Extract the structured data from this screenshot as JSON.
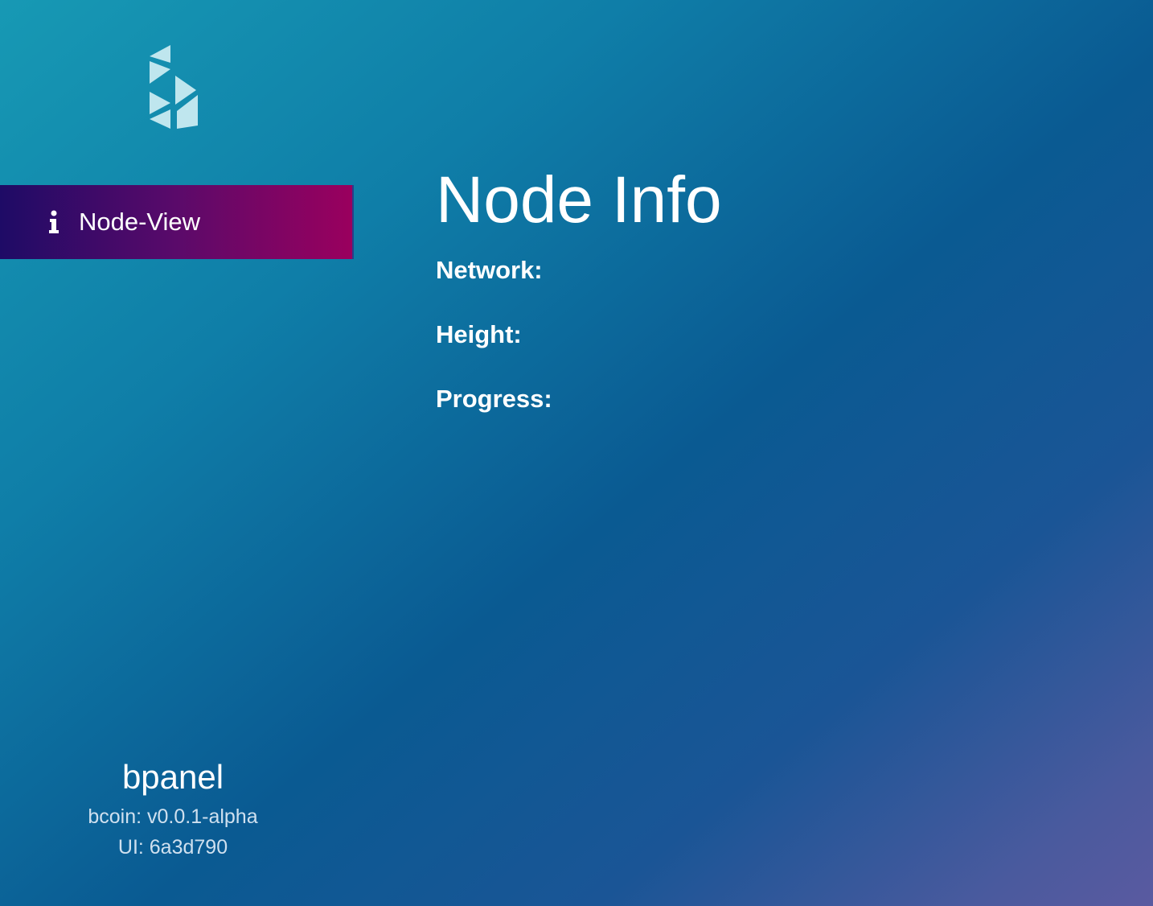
{
  "sidebar": {
    "logo_icon": "bcoin-logo-icon",
    "nav_items": [
      {
        "label": "Node-View",
        "icon": "info-icon"
      }
    ],
    "footer": {
      "app_name": "bpanel",
      "bcoin_version": "bcoin: v0.0.1-alpha",
      "ui_version": "UI: 6a3d790"
    }
  },
  "main": {
    "title": "Node Info",
    "fields": [
      {
        "label": "Network:",
        "value": ""
      },
      {
        "label": "Height:",
        "value": ""
      },
      {
        "label": "Progress:",
        "value": ""
      }
    ]
  },
  "colors": {
    "nav_active_start": "#1e0b66",
    "nav_active_end": "#9a005e",
    "bg_top_left": "#1799b4",
    "bg_bottom_right": "#5a5aa0"
  }
}
